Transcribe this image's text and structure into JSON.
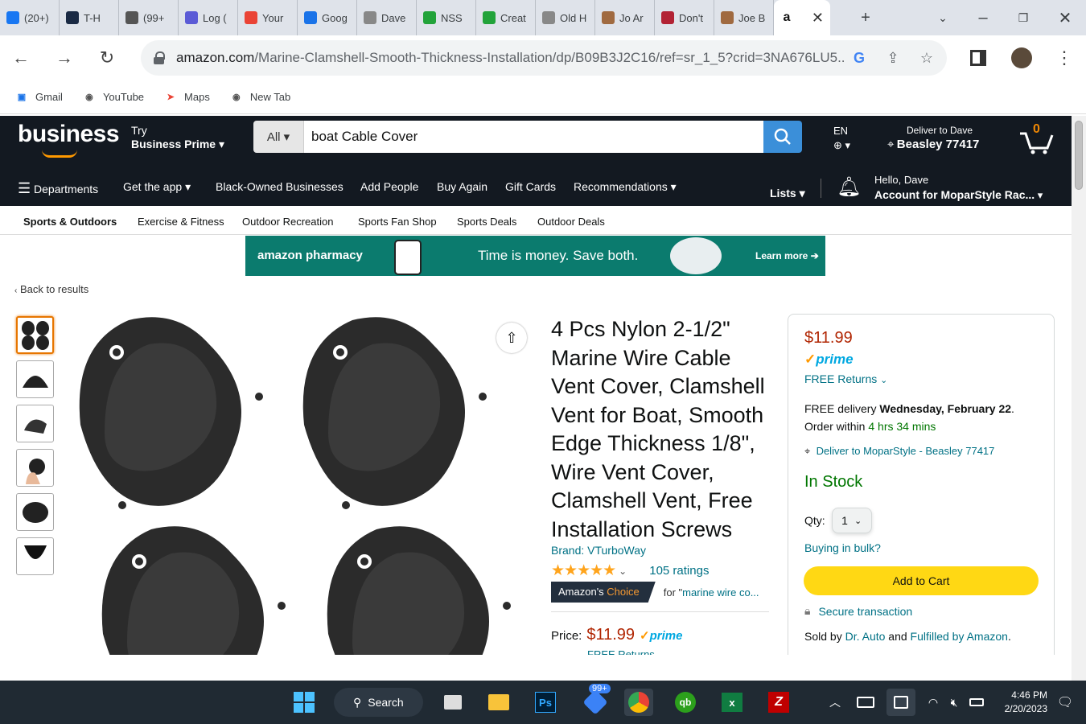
{
  "browser": {
    "tabs": [
      {
        "label": "(20+)",
        "icon": "facebook-icon",
        "color": "#1877f2"
      },
      {
        "label": "T-H",
        "icon": "app-icon",
        "color": "#1a2a44"
      },
      {
        "label": "(99+",
        "icon": "dots-icon",
        "color": "#555"
      },
      {
        "label": "Log (",
        "icon": "pinwheel-icon",
        "color": "#5b5bd6"
      },
      {
        "label": "Your",
        "icon": "gmail-icon",
        "color": "#ea4335"
      },
      {
        "label": "Goog",
        "icon": "calendar-icon",
        "color": "#1a73e8"
      },
      {
        "label": "Dave",
        "icon": "ghost-icon",
        "color": "#888"
      },
      {
        "label": "NSS",
        "icon": "green-circle-icon",
        "color": "#22a33a"
      },
      {
        "label": "Creat",
        "icon": "green-circle-icon",
        "color": "#22a33a"
      },
      {
        "label": "Old H",
        "icon": "ghost-icon",
        "color": "#888"
      },
      {
        "label": "Jo Ar",
        "icon": "photo-icon",
        "color": "#a06a40"
      },
      {
        "label": "Don't",
        "icon": "flag-icon",
        "color": "#b22234"
      },
      {
        "label": "Joe B",
        "icon": "photo-icon",
        "color": "#a06a40"
      }
    ],
    "active_tab_icon": "a",
    "url_host": "amazon.com",
    "url_path": "/Marine-Clamshell-Smooth-Thickness-Installation/dp/B09B3J2C16/ref=sr_1_5?crid=3NA676LU5...",
    "bookmarks": [
      {
        "label": "Gmail",
        "icon": "calendar-icon"
      },
      {
        "label": "YouTube",
        "icon": "ghost-icon"
      },
      {
        "label": "Maps",
        "icon": "maps-icon"
      },
      {
        "label": "New Tab",
        "icon": "ghost-icon"
      }
    ]
  },
  "amazon": {
    "logo": "business",
    "try_line1": "Try",
    "try_line2": "Business Prime",
    "search_category": "All",
    "search_value": "boat Cable Cover",
    "lang": "EN",
    "deliver_line1": "Deliver to Dave",
    "deliver_line2": "Beasley 77417",
    "cart_count": "0",
    "nav": [
      "Departments",
      "Get the app",
      "Black-Owned Businesses",
      "Add People",
      "Buy Again",
      "Gift Cards",
      "Recommendations"
    ],
    "lists": "Lists",
    "hello": "Hello, Dave",
    "account": "Account for MoparStyle Rac...",
    "subnav": [
      "Sports & Outdoors",
      "Exercise & Fitness",
      "Outdoor Recreation",
      "Sports Fan Shop",
      "Sports Deals",
      "Outdoor Deals"
    ],
    "banner": {
      "brand": "amazon pharmacy",
      "tagline": "Time is money. Save both.",
      "cta": "Learn more"
    },
    "back": "Back to results"
  },
  "product": {
    "title": "4 Pcs Nylon 2-1/2\" Marine Wire Cable Vent Cover, Clamshell Vent for Boat, Smooth Edge Thickness 1/8\", Wire Vent Cover, Clamshell Vent, Free Installation Screws",
    "brand": "Brand: VTurboWay",
    "stars": "★★★★★",
    "ratings": "105 ratings",
    "choice_label": "Amazon's",
    "choice_word": "Choice",
    "choice_for": "for \"",
    "choice_keyword": "marine wire co...",
    "price_label": "Price:",
    "price": "$11.99",
    "prime": "prime",
    "free_returns": "FREE Returns"
  },
  "buybox": {
    "price": "$11.99",
    "prime": "prime",
    "returns": "FREE Returns",
    "delivery_prefix": "FREE delivery ",
    "delivery_date": "Wednesday, February 22",
    "delivery_suffix": ".",
    "order_within": "Order within ",
    "countdown": "4 hrs 34 mins",
    "address": "Deliver to MoparStyle - Beasley 77417",
    "stock": "In Stock",
    "qty_label": "Qty:",
    "qty": "1",
    "bulk": "Buying in bulk?",
    "add_to_cart": "Add to Cart",
    "secure": "Secure transaction",
    "sold_by_prefix": "Sold by ",
    "seller": "Dr. Auto",
    "and": " and ",
    "fulfilled": "Fulfilled by Amazon",
    "period": "."
  },
  "taskbar": {
    "search": "Search",
    "badge": "99+",
    "time": "4:46 PM",
    "date": "2/20/2023"
  }
}
